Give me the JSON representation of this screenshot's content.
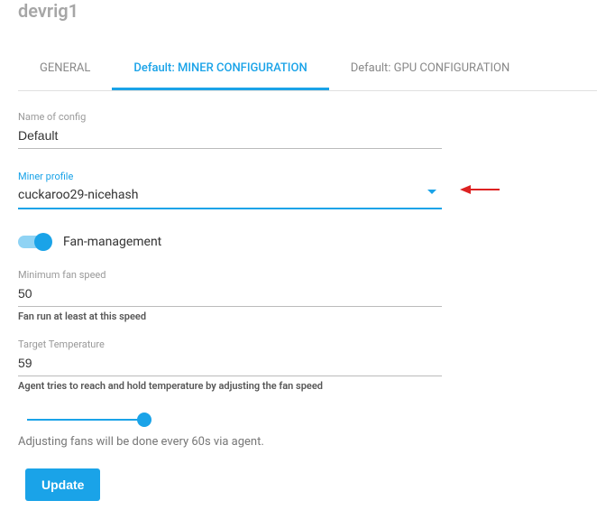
{
  "header": {
    "title": "devrig1"
  },
  "tabs": {
    "general": "GENERAL",
    "miner": "Default: MINER CONFIGURATION",
    "gpu": "Default: GPU CONFIGURATION"
  },
  "form": {
    "name_label": "Name of config",
    "name_value": "Default",
    "profile_label": "Miner profile",
    "profile_value": "cuckaroo29-nicehash",
    "fan_toggle_label": "Fan-management",
    "min_fan_label": "Minimum fan speed",
    "min_fan_value": "50",
    "min_fan_help": "Fan run at least at this speed",
    "target_temp_label": "Target Temperature",
    "target_temp_value": "59",
    "target_temp_help": "Agent tries to reach and hold temperature by adjusting the fan speed",
    "interval_info": "Adjusting fans will be done every 60s via agent.",
    "update_button": "Update"
  }
}
